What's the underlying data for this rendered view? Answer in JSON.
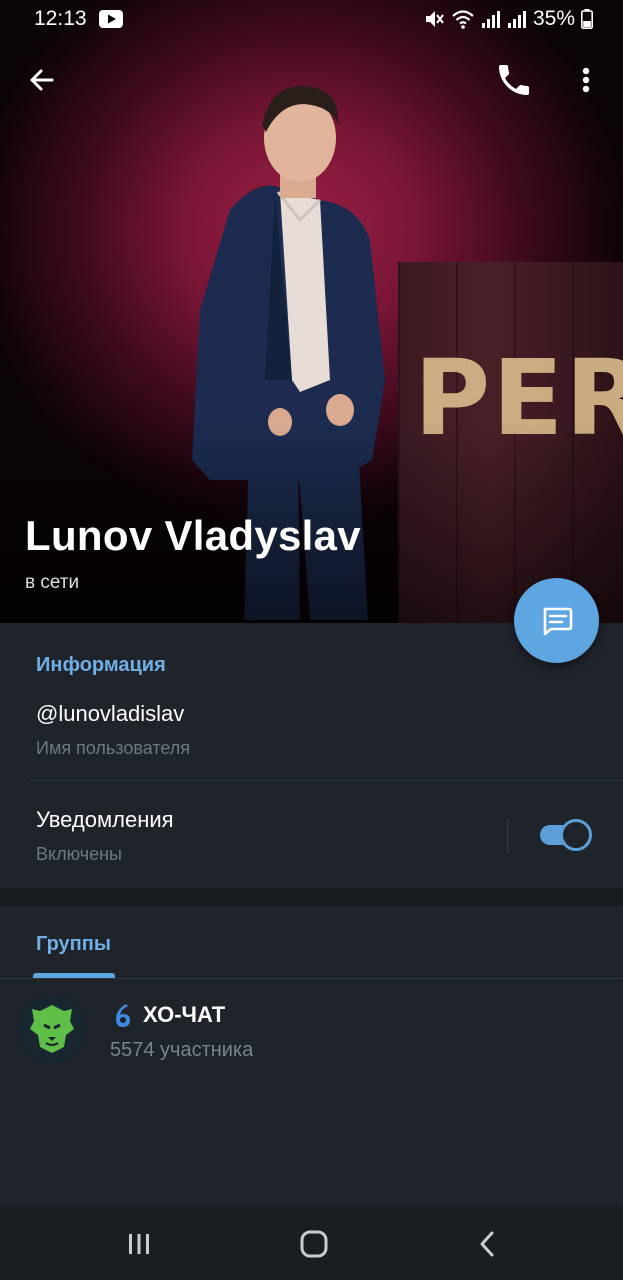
{
  "status_bar": {
    "time": "12:13",
    "battery": "35%",
    "icons": [
      "youtube-icon",
      "mute-icon",
      "wifi-icon",
      "signal-icon",
      "signal-icon",
      "battery-icon"
    ]
  },
  "top_bar": {
    "icons": [
      "back-arrow-icon",
      "phone-icon",
      "more-vert-icon"
    ]
  },
  "profile": {
    "name": "Lunov Vladyslav",
    "status": "в сети",
    "photo_sign_text": "PERF"
  },
  "info": {
    "section_title": "Информация",
    "username": "@lunovladislav",
    "username_label": "Имя пользователя",
    "notifications_title": "Уведомления",
    "notifications_state": "Включены",
    "notifications_on": true
  },
  "groups": {
    "section_title": "Группы",
    "items": [
      {
        "name": "ХО-ЧАТ",
        "members": "5574 участника",
        "icon": "lion-avatar"
      }
    ]
  },
  "colors": {
    "accent": "#5ea6e2",
    "section_title": "#71aee6",
    "background": "#1f232a"
  },
  "nav_bar": {
    "icons": [
      "recents-icon",
      "home-icon",
      "nav-back-icon"
    ]
  }
}
